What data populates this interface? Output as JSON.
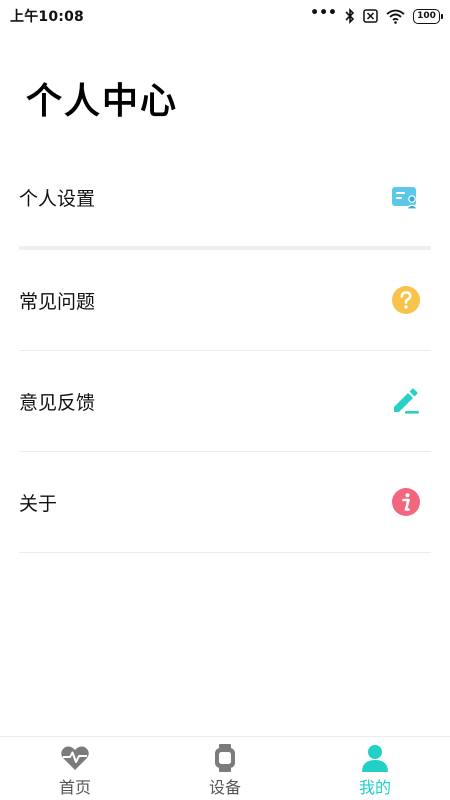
{
  "status_bar": {
    "time": "上午10:08",
    "dots": "•••",
    "battery": "100"
  },
  "page": {
    "title": "个人中心"
  },
  "menu": {
    "items": [
      {
        "label": "个人设置",
        "icon": "profile-card-icon",
        "color": "#5cc7e8"
      },
      {
        "label": "常见问题",
        "icon": "question-icon",
        "color": "#f7c34a"
      },
      {
        "label": "意见反馈",
        "icon": "edit-pencil-icon",
        "color": "#28d1c5"
      },
      {
        "label": "关于",
        "icon": "info-icon",
        "color": "#f2677e"
      }
    ]
  },
  "bottom_nav": {
    "items": [
      {
        "label": "首页",
        "icon": "heartbeat-icon"
      },
      {
        "label": "设备",
        "icon": "watch-icon"
      },
      {
        "label": "我的",
        "icon": "person-icon",
        "active": true
      }
    ],
    "active_color": "#22d0c6",
    "inactive_color": "#555555"
  }
}
